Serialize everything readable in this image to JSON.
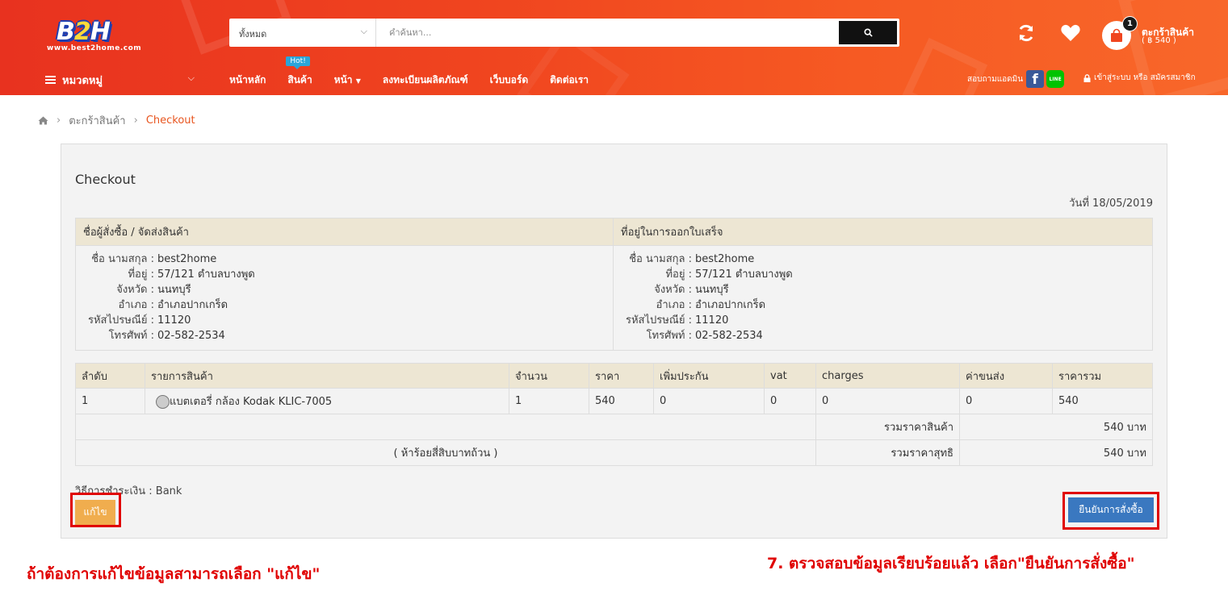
{
  "brand": {
    "logo_b": "B",
    "logo_2": "2",
    "logo_h": "H",
    "url": "www.best2home.com"
  },
  "search": {
    "category": "ทั้งหมด",
    "placeholder": "คำค้นหา..."
  },
  "cart": {
    "count": "1",
    "label": "ตะกร้าสินค้า",
    "amount": "( ฿ 540 )"
  },
  "nav": {
    "categories_label": "หมวดหมู่",
    "items": [
      "หน้าหลัก",
      "สินค้า",
      "หน้า",
      "ลงทะเบียนผลิตภัณฑ์",
      "เว็บบอร์ด",
      "ติดต่อเรา"
    ],
    "hot_badge": "Hot!",
    "contact_label": "สอบถามแอดมิน",
    "line_label": "LINE",
    "login_label": "เข้าสู่ระบบ หรือ สมัครสมาชิก"
  },
  "breadcrumb": {
    "cart": "ตะกร้าสินค้า",
    "current": "Checkout"
  },
  "checkout": {
    "title": "Checkout",
    "date": "วันที่ 18/05/2019",
    "shipping_header": "ชื่อผู้สั่งซื้อ / จัดส่งสินค้า",
    "billing_header": "ที่อยู่ในการออกใบเสร็จ",
    "shipping": [
      {
        "label": "ชื่อ นามสกุล :",
        "value": "best2home"
      },
      {
        "label": "ที่อยู่ :",
        "value": "57/121 ตำบลบางพูด"
      },
      {
        "label": "จังหวัด :",
        "value": "นนทบุรี"
      },
      {
        "label": "อำเภอ :",
        "value": "อำเภอปากเกร็ด"
      },
      {
        "label": "รหัสไปรษณีย์ :",
        "value": "11120"
      },
      {
        "label": "โทรศัพท์ :",
        "value": "02-582-2534"
      }
    ],
    "billing": [
      {
        "label": "ชื่อ นามสกุล :",
        "value": "best2home"
      },
      {
        "label": "ที่อยู่ :",
        "value": "57/121 ตำบลบางพูด"
      },
      {
        "label": "จังหวัด :",
        "value": "นนทบุรี"
      },
      {
        "label": "อำเภอ :",
        "value": "อำเภอปากเกร็ด"
      },
      {
        "label": "รหัสไปรษณีย์ :",
        "value": "11120"
      },
      {
        "label": "โทรศัพท์ :",
        "value": "02-582-2534"
      }
    ],
    "columns": [
      "ลำดับ",
      "รายการสินค้า",
      "จำนวน",
      "ราคา",
      "เพิ่มประกัน",
      "vat",
      "charges",
      "ค่าขนส่ง",
      "ราคารวม"
    ],
    "items": [
      {
        "no": "1",
        "name": "แบตเตอรี่ กล้อง Kodak KLIC-7005",
        "qty": "1",
        "price": "540",
        "insurance": "0",
        "vat": "0",
        "charges": "0",
        "shipping": "0",
        "total": "540"
      }
    ],
    "subtotal_label": "รวมราคาสินค้า",
    "subtotal_value": "540 บาท",
    "amount_in_words": "( ห้าร้อยสี่สิบบาทถ้วน )",
    "net_label": "รวมราคาสุทธิ",
    "net_value": "540 บาท",
    "payment_method": "วิธีการชำระเงิน : Bank",
    "edit_label": "แก้ไข",
    "confirm_label": "ยืนยันการสั่งซื้อ"
  },
  "annotations": {
    "left": "ถ้าต้องการแก้ไขข้อมูลสามารถเลือก \"แก้ไข\"",
    "right": "7. ตรวจสอบข้อมูลเรียบร้อยแล้ว เลือก\"ยืนยันการสั่งซื้อ\""
  },
  "colors": {
    "header": "#f0451f",
    "accent": "#e8551f",
    "edit_button": "#f0ad4e",
    "confirm_button": "#3a78c0",
    "annotation": "#e00000"
  }
}
